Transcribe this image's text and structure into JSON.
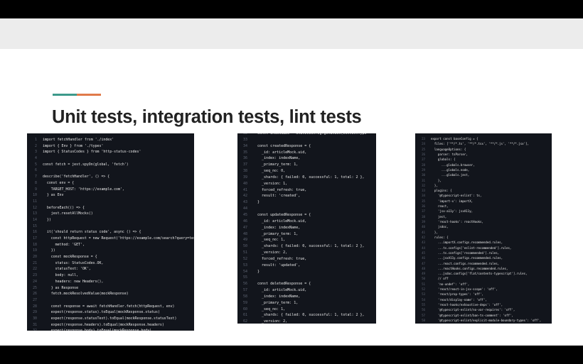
{
  "slide": {
    "title": "Unit tests, integration tests, lint tests",
    "accent_colors": [
      "#3d9a8b",
      "#e07a4a"
    ]
  },
  "panels": [
    {
      "lines": [
        {
          "n": "1",
          "t": "import fetchHandler from './index'"
        },
        {
          "n": "2",
          "t": "import { Env } from './types'"
        },
        {
          "n": "3",
          "t": "import { StatusCodes } from 'http-status-codes'"
        },
        {
          "n": "4",
          "t": ""
        },
        {
          "n": "5",
          "t": "const fetch = jest.spyOn(global, 'fetch')"
        },
        {
          "n": "6",
          "t": ""
        },
        {
          "n": "7",
          "t": "describe('fetchHandler', () => {"
        },
        {
          "n": "8",
          "t": "  const env = {"
        },
        {
          "n": "9",
          "t": "    TARGET_HOST: 'https://example.com',"
        },
        {
          "n": "10",
          "t": "  } as Env"
        },
        {
          "n": "11",
          "t": ""
        },
        {
          "n": "12",
          "t": "  beforeEach(() => {"
        },
        {
          "n": "13",
          "t": "    jest.resetAllMocks()"
        },
        {
          "n": "14",
          "t": "  })"
        },
        {
          "n": "15",
          "t": ""
        },
        {
          "n": "16",
          "t": "  it('should return status code', async () => {"
        },
        {
          "n": "17",
          "t": "    const httpRequest = new Request('https://example.com/search?query=test', {"
        },
        {
          "n": "18",
          "t": "      method: 'GET',"
        },
        {
          "n": "19",
          "t": "    })"
        },
        {
          "n": "20",
          "t": "    const mockResponse = {"
        },
        {
          "n": "21",
          "t": "      status: StatusCodes.OK,"
        },
        {
          "n": "22",
          "t": "      statusText: 'OK',"
        },
        {
          "n": "23",
          "t": "      body: null,"
        },
        {
          "n": "24",
          "t": "      headers: new Headers(),"
        },
        {
          "n": "25",
          "t": "    } as Response"
        },
        {
          "n": "26",
          "t": "    fetch.mockResolvedValue(mockResponse)"
        },
        {
          "n": "27",
          "t": ""
        },
        {
          "n": "28",
          "t": "    const response = await fetchHandler.fetch(httpRequest, env)"
        },
        {
          "n": "29",
          "t": "    expect(response.status).toEqual(mockResponse.status)"
        },
        {
          "n": "30",
          "t": "    expect(response.statusText).toEqual(mockResponse.statusText)"
        },
        {
          "n": "31",
          "t": "    expect(response.headers).toEqual(mockResponse.headers)"
        },
        {
          "n": "32",
          "t": "    expect(response.body).toEqual(mockResponse.body)"
        },
        {
          "n": "33",
          "t": "  })"
        },
        {
          "n": "34",
          "t": "})"
        }
      ]
    },
    {
      "lines": [
        {
          "n": "32",
          "t": "  const indexName = StaticConfig.getIndex(contentType"
        },
        {
          "n": "33",
          "t": ""
        },
        {
          "n": "34",
          "t": "  const createdResponse = {"
        },
        {
          "n": "35",
          "t": "    _id: articleMock.uid,"
        },
        {
          "n": "36",
          "t": "    _index: indexName,"
        },
        {
          "n": "37",
          "t": "    _primary_term: 1,"
        },
        {
          "n": "38",
          "t": "    _seq_no: 0,"
        },
        {
          "n": "39",
          "t": "    _shards: { failed: 0, successful: 1, total: 2 },"
        },
        {
          "n": "40",
          "t": "    _version: 1,"
        },
        {
          "n": "41",
          "t": "    forced_refresh: true,"
        },
        {
          "n": "42",
          "t": "    result: 'created',"
        },
        {
          "n": "43",
          "t": "  }"
        },
        {
          "n": "44",
          "t": ""
        },
        {
          "n": "45",
          "t": "  const updatedResponse = {"
        },
        {
          "n": "46",
          "t": "    _id: articleMock.uid,"
        },
        {
          "n": "47",
          "t": "    _index: indexName,"
        },
        {
          "n": "48",
          "t": "    _primary_term: 1,"
        },
        {
          "n": "49",
          "t": "    _seq_no: 1,"
        },
        {
          "n": "50",
          "t": "    _shards: { failed: 0, successful: 1, total: 2 },"
        },
        {
          "n": "51",
          "t": "    _version: 2,"
        },
        {
          "n": "52",
          "t": "    forced_refresh: true,"
        },
        {
          "n": "53",
          "t": "    result: 'updated',"
        },
        {
          "n": "54",
          "t": "  }"
        },
        {
          "n": "55",
          "t": ""
        },
        {
          "n": "56",
          "t": "  const deletedResponse = {"
        },
        {
          "n": "57",
          "t": "    _id: articleMock.uid,"
        },
        {
          "n": "58",
          "t": "    _index: indexName,"
        },
        {
          "n": "59",
          "t": "    _primary_term: 1,"
        },
        {
          "n": "60",
          "t": "    _seq_no: 1,"
        },
        {
          "n": "61",
          "t": "    _shards: { failed: 0, successful: 1, total: 2 },"
        },
        {
          "n": "62",
          "t": "    _version: 2,"
        },
        {
          "n": "63",
          "t": "    result: 'deleted',"
        },
        {
          "n": "64",
          "t": "  }"
        },
        {
          "n": "65",
          "t": ""
        }
      ]
    },
    {
      "lines": [
        {
          "n": "23",
          "t": "export const baseConfig = {"
        },
        {
          "n": "24",
          "t": "  files: ['**/*.ts', '**/*.tsx', '**/*.js', '**/*.jsx'],"
        },
        {
          "n": "25",
          "t": "  languageOptions: {"
        },
        {
          "n": "26",
          "t": "    parser: tsParser,"
        },
        {
          "n": "27",
          "t": "    globals: {"
        },
        {
          "n": "28",
          "t": "      ...globals.browser,"
        },
        {
          "n": "29",
          "t": "      ...globals.node,"
        },
        {
          "n": "30",
          "t": "      ...globals.jest,"
        },
        {
          "n": "31",
          "t": "    },"
        },
        {
          "n": "32",
          "t": "  },"
        },
        {
          "n": "33",
          "t": "  plugins: {"
        },
        {
          "n": "34",
          "t": "    '@typescript-eslint': ts,"
        },
        {
          "n": "35",
          "t": "    'import-x': importX,"
        },
        {
          "n": "36",
          "t": "    react,"
        },
        {
          "n": "37",
          "t": "    'jsx-a11y': jsxA11y,"
        },
        {
          "n": "38",
          "t": "    jest,"
        },
        {
          "n": "39",
          "t": "    'react-hooks': reactHooks,"
        },
        {
          "n": "40",
          "t": "    jsdoc,"
        },
        {
          "n": "41",
          "t": "  },"
        },
        {
          "n": "42",
          "t": "  rules: {"
        },
        {
          "n": "43",
          "t": "    ...importX.configs.recommended.rules,"
        },
        {
          "n": "44",
          "t": "    ...ts.configs['eslint-recommended'].rules,"
        },
        {
          "n": "45",
          "t": "    ...ts.configs['recommended'].rules,"
        },
        {
          "n": "46",
          "t": "    ...jsxA11y.configs.recommended.rules,"
        },
        {
          "n": "47",
          "t": "    ...react.configs.recommended.rules,"
        },
        {
          "n": "48",
          "t": "    ...reactHooks.configs.recommended.rules,"
        },
        {
          "n": "49",
          "t": "    ...jsdoc.configs['flat/contents-typescript'].rules,"
        },
        {
          "n": "50",
          "t": "    // off"
        },
        {
          "n": "51",
          "t": "    'no-undef': 'off',"
        },
        {
          "n": "52",
          "t": "    'react/react-in-jsx-scope': 'off',"
        },
        {
          "n": "53",
          "t": "    'react/prop-types': 'off',"
        },
        {
          "n": "54",
          "t": "    'react/display-name': 'off',"
        },
        {
          "n": "55",
          "t": "    'react-hooks/exhaustive-deps': 'off',"
        },
        {
          "n": "56",
          "t": "    '@typescript-eslint/no-var-requires': 'off',"
        },
        {
          "n": "57",
          "t": "    '@typescript-eslint/ban-ts-comment': 'off',"
        },
        {
          "n": "58",
          "t": "    '@typescript-eslint/explicit-module-boundary-types': 'off',"
        },
        {
          "n": "59",
          "t": "    'import-x/no-unresolved': 'off',"
        },
        {
          "n": "60",
          "t": "    '@typescript-eslint/no-empty-function': 'off',"
        },
        {
          "n": "61",
          "t": "    '@typescript-eslint/no-explicit-any': 'off',"
        },
        {
          "n": "62",
          "t": "    '@typescript-eslint/no-non-null-assertion': 'off',"
        }
      ]
    }
  ]
}
